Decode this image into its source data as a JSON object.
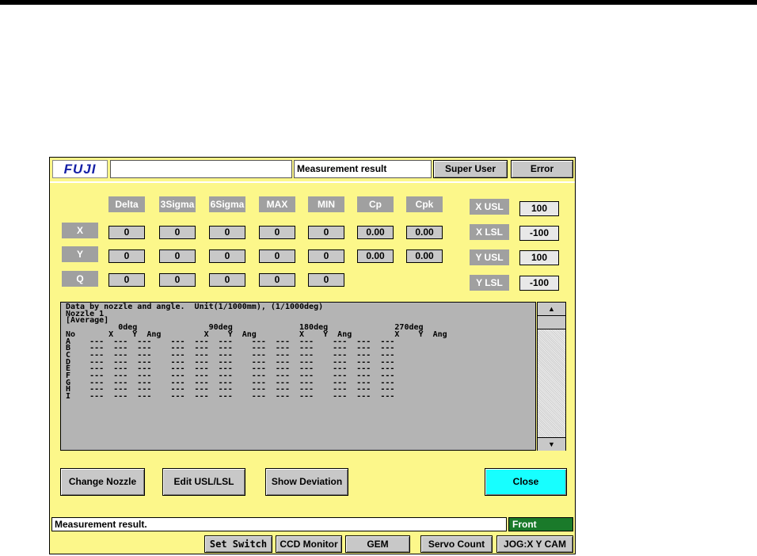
{
  "header": {
    "logo": "FUJI",
    "title": "Measurement result",
    "user_button": "Super User",
    "error_button": "Error"
  },
  "stats": {
    "columns": [
      "Delta",
      "3Sigma",
      "6Sigma",
      "MAX",
      "MIN",
      "Cp",
      "Cpk"
    ],
    "rows": [
      {
        "label": "X",
        "values": [
          "0",
          "0",
          "0",
          "0",
          "0",
          "0.00",
          "0.00"
        ]
      },
      {
        "label": "Y",
        "values": [
          "0",
          "0",
          "0",
          "0",
          "0",
          "0.00",
          "0.00"
        ]
      },
      {
        "label": "Q",
        "values": [
          "0",
          "0",
          "0",
          "0",
          "0"
        ]
      }
    ]
  },
  "limits": [
    {
      "label": "X USL",
      "value": "100"
    },
    {
      "label": "X LSL",
      "value": "-100"
    },
    {
      "label": "Y USL",
      "value": "100"
    },
    {
      "label": "Y LSL",
      "value": "-100"
    }
  ],
  "list": {
    "line1": "Data by nozzle and angle.  Unit(1/1000mm), (1/1000deg)",
    "line2": "Nozzle 1",
    "line3": "[Average]",
    "angles": [
      "0deg",
      "90deg",
      "180deg",
      "270deg"
    ],
    "no_label": "No",
    "col_labels": [
      "X",
      "Y",
      "Ang"
    ],
    "rows": [
      "A",
      "B",
      "C",
      "D",
      "E",
      "F",
      "G",
      "H",
      "I"
    ],
    "empty": "---"
  },
  "scroll": {
    "up": "▲",
    "down": "▼"
  },
  "actions": {
    "change_nozzle": "Change Nozzle",
    "edit_limits": "Edit USL/LSL",
    "show_deviation": "Show Deviation",
    "close": "Close"
  },
  "status": {
    "message": "Measurement result.",
    "mode": "Front"
  },
  "footer": {
    "set_switch": "Set Switch",
    "ccd_monitor": "CCD Monitor",
    "gem": "GEM",
    "servo_count": "Servo Count",
    "jog": "JOG:X Y CAM"
  }
}
